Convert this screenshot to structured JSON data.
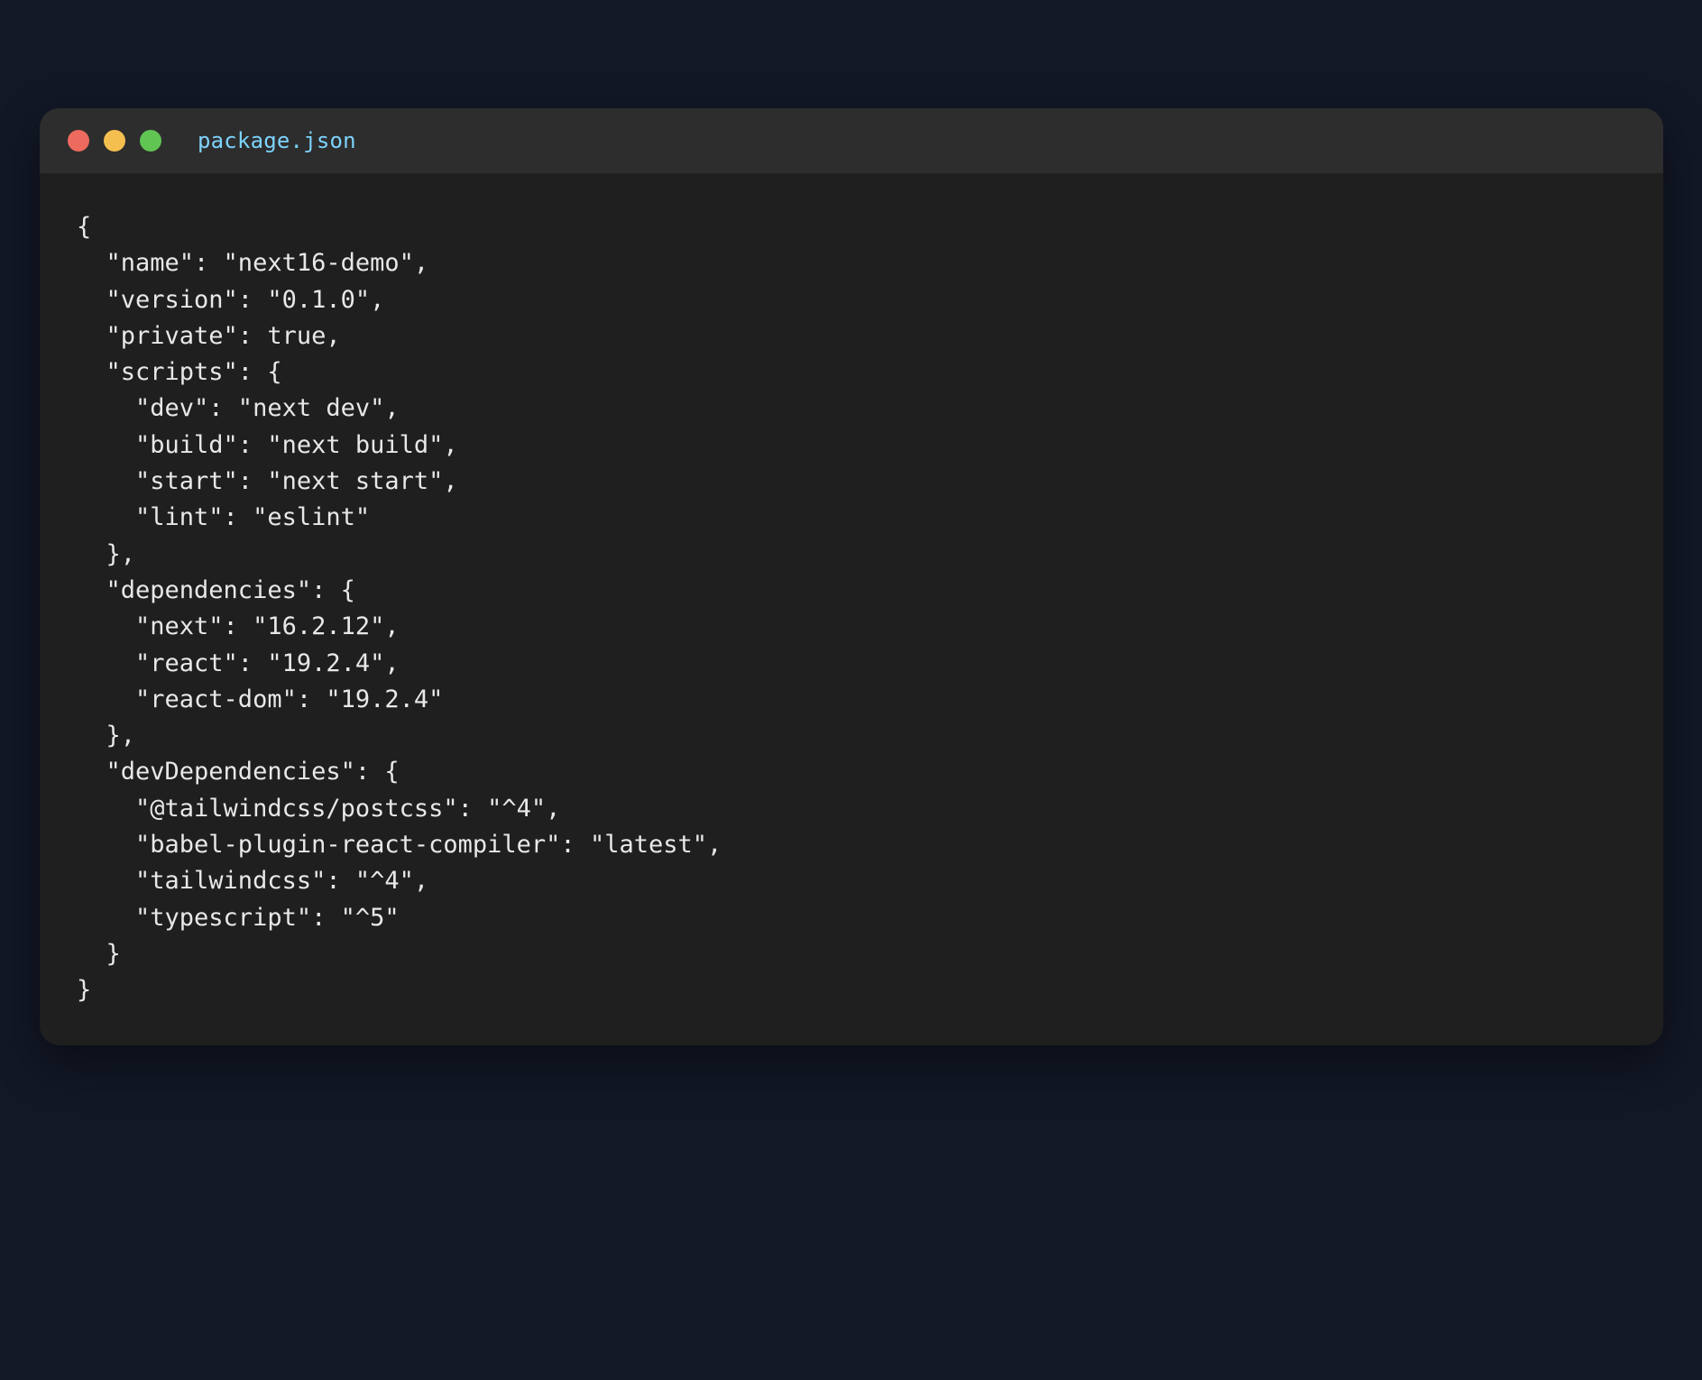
{
  "window": {
    "title": "package.json",
    "controls": {
      "close": {
        "icon": "close-dot-icon",
        "color": "#ed6a5e"
      },
      "minimize": {
        "icon": "minimize-dot-icon",
        "color": "#f5bf4f"
      },
      "maximize": {
        "icon": "maximize-dot-icon",
        "color": "#61c554"
      }
    }
  },
  "code": {
    "lines": [
      "{",
      "  \"name\": \"next16-demo\",",
      "  \"version\": \"0.1.0\",",
      "  \"private\": true,",
      "  \"scripts\": {",
      "    \"dev\": \"next dev\",",
      "    \"build\": \"next build\",",
      "    \"start\": \"next start\",",
      "    \"lint\": \"eslint\"",
      "  },",
      "  \"dependencies\": {",
      "    \"next\": \"16.2.12\",",
      "    \"react\": \"19.2.4\",",
      "    \"react-dom\": \"19.2.4\"",
      "  },",
      "  \"devDependencies\": {",
      "    \"@tailwindcss/postcss\": \"^4\",",
      "    \"babel-plugin-react-compiler\": \"latest\",",
      "    \"tailwindcss\": \"^4\",",
      "    \"typescript\": \"^5\"",
      "  }",
      "}"
    ]
  },
  "colors": {
    "page_background": "#121826",
    "window_background": "#1f1f1f",
    "titlebar_background": "#2d2d2d",
    "title_text": "#7dd3fc",
    "code_text": "#e8e8e8"
  }
}
